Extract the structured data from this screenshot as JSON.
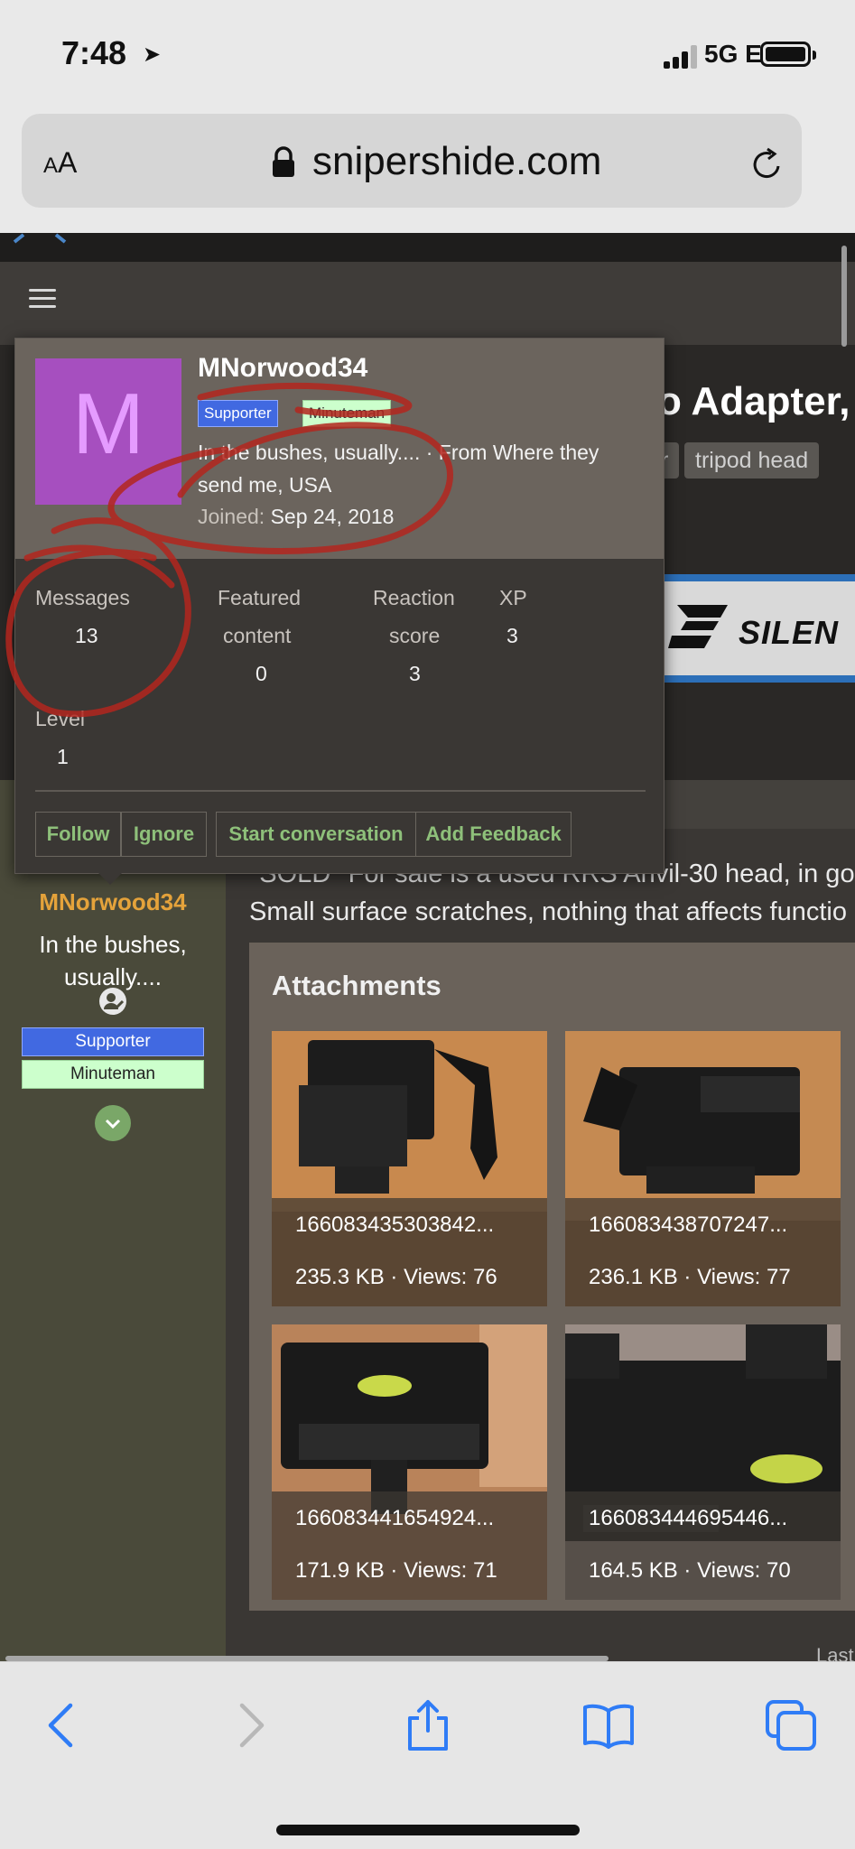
{
  "status_bar": {
    "time": "7:48",
    "network": "5G E"
  },
  "browser": {
    "aa_label_big": "A",
    "aa_label_small": "A",
    "url": "snipershide.com"
  },
  "thread": {
    "title_fragment": "o Adapter,",
    "tags": [
      "r",
      "tripod head"
    ],
    "banner_text": "SILEN"
  },
  "member_card": {
    "avatar_letter": "M",
    "username": "MNorwood34",
    "badges": [
      "Supporter",
      "Minuteman"
    ],
    "bio": "In the bushes, usually.... · From Where they send me, USA",
    "joined_label": "Joined:",
    "joined_date": "Sep 24, 2018",
    "stats": {
      "messages_label": "Messages",
      "messages_value": "13",
      "featured_label_1": "Featured",
      "featured_label_2": "content",
      "featured_value": "0",
      "reaction_label_1": "Reaction",
      "reaction_label_2": "score",
      "reaction_value": "3",
      "xp_label": "XP",
      "xp_value": "3",
      "level_label": "Level",
      "level_value": "1"
    },
    "buttons": {
      "follow": "Follow",
      "ignore": "Ignore",
      "start_conversation": "Start conversation",
      "add_feedback": "Add Feedback"
    }
  },
  "post": {
    "line1": "*SOLD* For sale is a used RRS Anvil-30 head, in goo",
    "line2": "Small surface scratches, nothing that affects functio"
  },
  "sidebar": {
    "username": "MNorwood34",
    "user_title_1": "In the bushes,",
    "user_title_2": "usually....",
    "badges": [
      "Supporter",
      "Minuteman"
    ]
  },
  "attachments": {
    "title": "Attachments",
    "items": [
      {
        "name": "166083435303842...",
        "meta": "235.3 KB · Views: 76"
      },
      {
        "name": "166083438707247...",
        "meta": "236.1 KB · Views: 77"
      },
      {
        "name": "166083441654924...",
        "meta": "171.9 KB · Views: 71"
      },
      {
        "name": "166083444695446...",
        "meta": "164.5 KB · Views: 70"
      }
    ]
  },
  "footer_fragment": "Last",
  "icons": {
    "back": "chevron-left-icon",
    "forward": "chevron-right-icon",
    "share": "share-icon",
    "bookmarks": "book-icon",
    "tabs": "tabs-icon"
  },
  "colors": {
    "accent_green": "#8ec07a",
    "supporter_badge": "#4169e1",
    "minuteman_badge": "#ccffcc",
    "username_orange": "#e5a33b",
    "avatar_purple": "#a64fbf",
    "ios_blue": "#2f7cf6",
    "annotation_red": "#b3261e"
  }
}
